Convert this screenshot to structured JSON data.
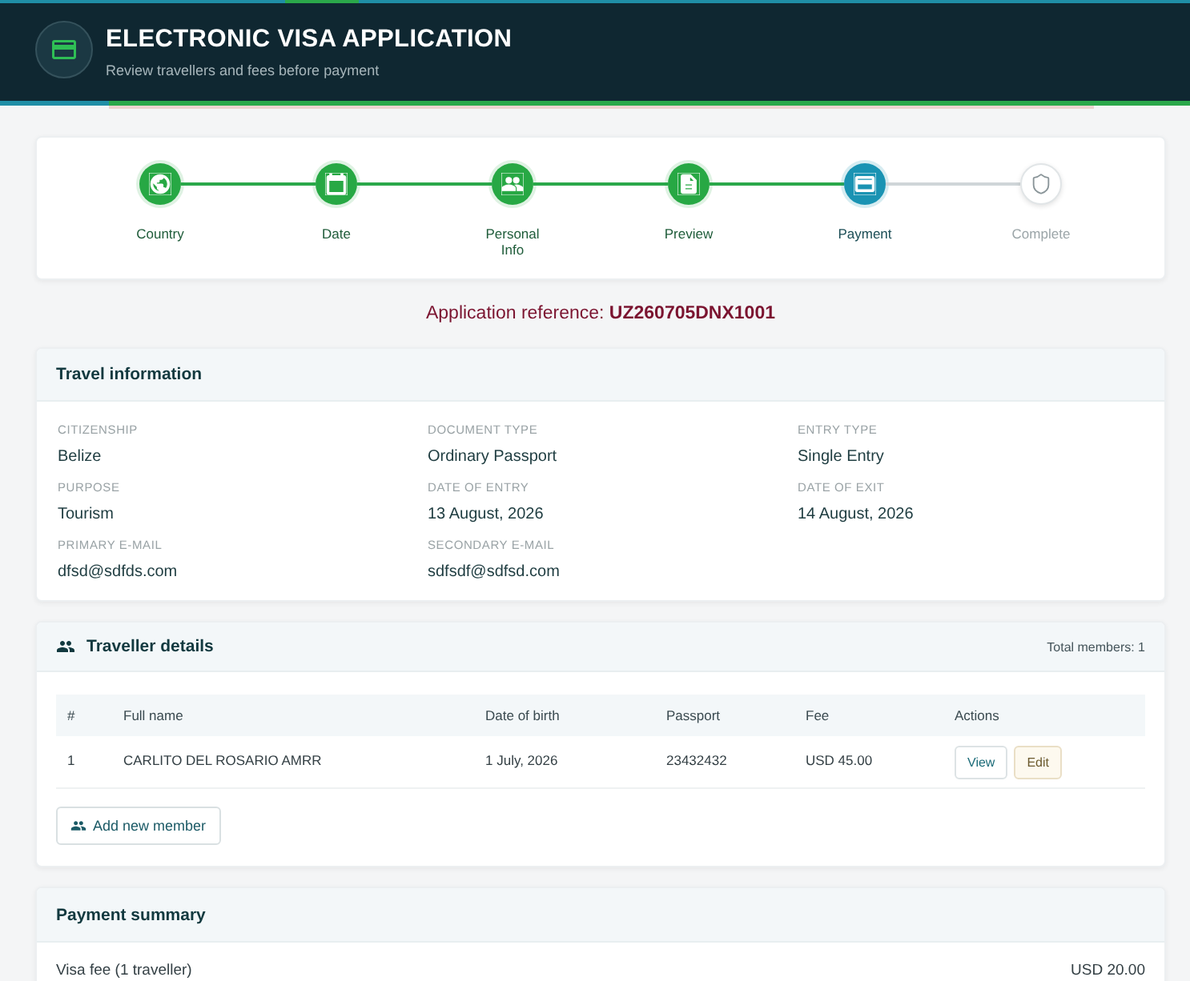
{
  "header": {
    "title": "ELECTRONIC VISA APPLICATION",
    "subtitle": "Review travellers and fees before payment"
  },
  "steps": [
    {
      "label": "Country",
      "completed": true,
      "selected": false
    },
    {
      "label": "Date",
      "completed": true,
      "selected": false
    },
    {
      "label": "Personal Info",
      "completed": true,
      "selected": false
    },
    {
      "label": "Preview",
      "completed": true,
      "selected": false
    },
    {
      "label": "Payment",
      "completed": false,
      "selected": true
    },
    {
      "label": "Complete",
      "completed": false,
      "selected": false
    }
  ],
  "reference": "Application reference: **UZ260705DNX1001**",
  "travel_information": {
    "title": "Travel information",
    "fields": [
      {
        "label": "CITIZENSHIP",
        "value": "Belize"
      },
      {
        "label": "DOCUMENT TYPE",
        "value": "Ordinary Passport"
      },
      {
        "label": "ENTRY TYPE",
        "value": "Single Entry"
      },
      {
        "label": "PURPOSE",
        "value": "Tourism"
      },
      {
        "label": "DATE OF ENTRY",
        "value": "13 August, 2026"
      },
      {
        "label": "DATE OF EXIT",
        "value": "14 August, 2026"
      },
      {
        "label": "PRIMARY E-MAIL",
        "value": "dfsd@sdfds.com"
      },
      {
        "label": "SECONDARY E-MAIL",
        "value": "sdfsdf@sdfsd.com"
      }
    ]
  },
  "traveller_details": {
    "title": "Traveller details",
    "total": "Total members: 1",
    "table": {
      "columns": [
        "#",
        "Full name",
        "Date of birth",
        "Passport",
        "Fee",
        "Actions"
      ],
      "rows": [
        {
          "cells": [
            "1",
            "CARLITO DEL ROSARIO AMRR",
            "1 July, 2026",
            "23432432",
            "USD 45.00"
          ],
          "actions": [
            {
              "label": "View",
              "kind": "outline"
            },
            {
              "label": "Edit",
              "kind": "tinted"
            }
          ]
        }
      ]
    },
    "add_button": "Add new member"
  },
  "payment_summary": {
    "title": "Payment summary",
    "lines": [
      {
        "label": "Visa fee (1 traveller)",
        "amount": "USD 20.00"
      }
    ]
  }
}
